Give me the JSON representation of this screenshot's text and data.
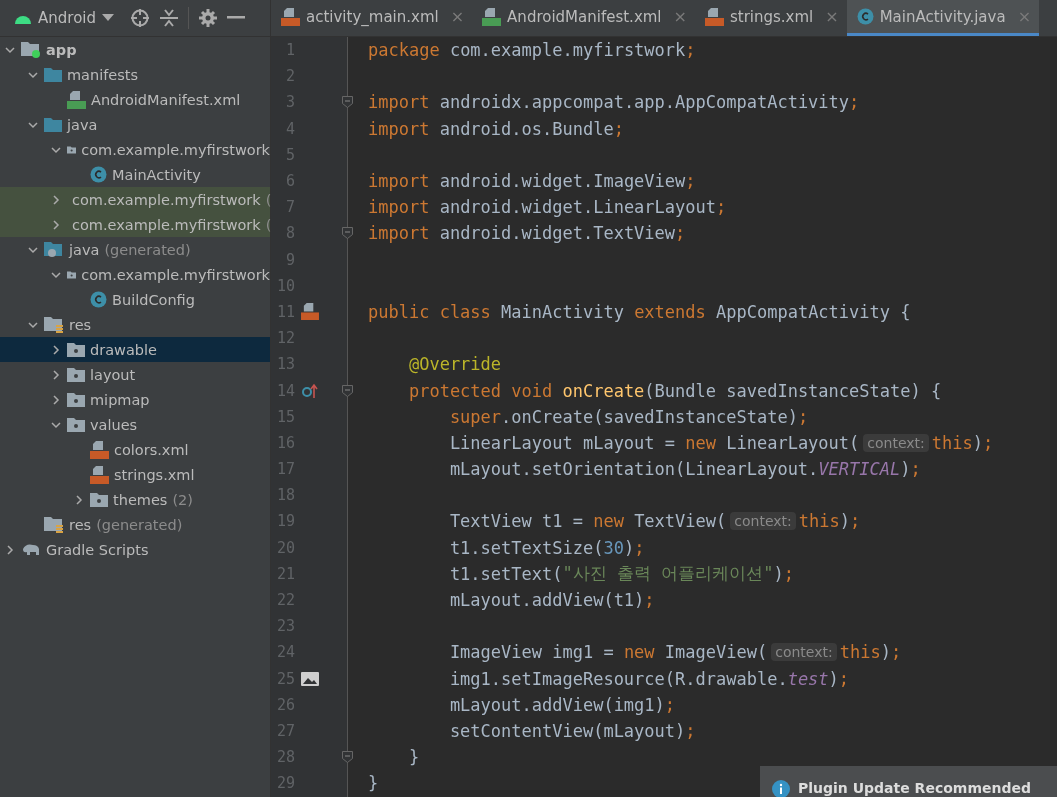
{
  "project_view": {
    "label": "Android"
  },
  "tabs": [
    {
      "label": "activity_main.xml",
      "kind": "xml",
      "selected": false,
      "close": "×"
    },
    {
      "label": "AndroidManifest.xml",
      "kind": "manifest",
      "selected": false,
      "close": "×"
    },
    {
      "label": "strings.xml",
      "kind": "xml",
      "selected": false,
      "close": "×"
    },
    {
      "label": "MainActivity.java",
      "kind": "class",
      "selected": true,
      "close": "×"
    }
  ],
  "tree": [
    {
      "label": "app",
      "kind": "module",
      "bold": true,
      "expanded": true,
      "selected": false,
      "highlighted": false,
      "children": [
        {
          "label": "manifests",
          "kind": "folder",
          "expanded": true,
          "selected": false,
          "highlighted": false,
          "children": [
            {
              "label": "AndroidManifest.xml",
              "kind": "manifest",
              "selected": false,
              "highlighted": false
            }
          ]
        },
        {
          "label": "java",
          "kind": "folder",
          "expanded": true,
          "selected": false,
          "highlighted": false,
          "children": [
            {
              "label": "com.example.myfirstwork",
              "kind": "package",
              "expanded": true,
              "selected": false,
              "highlighted": false,
              "children": [
                {
                  "label": "MainActivity",
                  "kind": "class",
                  "selected": false,
                  "highlighted": false
                }
              ]
            },
            {
              "label": "com.example.myfirstwork",
              "note": "(",
              "kind": "package",
              "expanded": false,
              "selected": false,
              "highlighted": true
            },
            {
              "label": "com.example.myfirstwork",
              "note": "(",
              "kind": "package",
              "expanded": false,
              "selected": false,
              "highlighted": true
            }
          ]
        },
        {
          "label": "java",
          "note": "(generated)",
          "kind": "generated",
          "expanded": true,
          "selected": false,
          "highlighted": false,
          "children": [
            {
              "label": "com.example.myfirstwork",
              "kind": "package",
              "expanded": true,
              "selected": false,
              "highlighted": false,
              "children": [
                {
                  "label": "BuildConfig",
                  "kind": "class",
                  "selected": false,
                  "highlighted": false
                }
              ]
            }
          ]
        },
        {
          "label": "res",
          "kind": "res",
          "expanded": true,
          "selected": false,
          "highlighted": false,
          "children": [
            {
              "label": "drawable",
              "kind": "package",
              "expanded": false,
              "selected": true,
              "highlighted": false
            },
            {
              "label": "layout",
              "kind": "package",
              "expanded": false,
              "selected": false,
              "highlighted": false
            },
            {
              "label": "mipmap",
              "kind": "package",
              "expanded": false,
              "selected": false,
              "highlighted": false
            },
            {
              "label": "values",
              "kind": "package",
              "expanded": true,
              "selected": false,
              "highlighted": false,
              "children": [
                {
                  "label": "colors.xml",
                  "kind": "xml",
                  "selected": false,
                  "highlighted": false
                },
                {
                  "label": "strings.xml",
                  "kind": "xml",
                  "selected": false,
                  "highlighted": false
                },
                {
                  "label": "themes",
                  "note": "(2)",
                  "kind": "package",
                  "expanded": false,
                  "selected": false,
                  "highlighted": false
                }
              ]
            }
          ]
        },
        {
          "label": "res",
          "note": "(generated)",
          "kind": "res",
          "selected": false,
          "highlighted": false
        }
      ]
    },
    {
      "label": "Gradle Scripts",
      "kind": "gradle",
      "expanded": false,
      "selected": false,
      "highlighted": false
    }
  ],
  "code": [
    {
      "number": "1",
      "kind": "plain",
      "tokens": [
        {
          "kind": "kw",
          "text": "package"
        },
        {
          "kind": "plain",
          "text": " com.example.myfirstwork"
        },
        {
          "kind": "kw",
          "text": ";"
        }
      ]
    },
    {
      "number": "2",
      "kind": "plain"
    },
    {
      "number": "3",
      "kind": "fold",
      "tokens": [
        {
          "kind": "kw",
          "text": "import"
        },
        {
          "kind": "plain",
          "text": " androidx.appcompat.app.AppCompatActivity"
        },
        {
          "kind": "kw",
          "text": ";"
        }
      ]
    },
    {
      "number": "4",
      "kind": "plain",
      "tokens": [
        {
          "kind": "kw",
          "text": "import"
        },
        {
          "kind": "plain",
          "text": " android.os.Bundle"
        },
        {
          "kind": "kw",
          "text": ";"
        }
      ]
    },
    {
      "number": "5",
      "kind": "plain"
    },
    {
      "number": "6",
      "kind": "plain",
      "tokens": [
        {
          "kind": "kw",
          "text": "import"
        },
        {
          "kind": "plain",
          "text": " android.widget.ImageView"
        },
        {
          "kind": "kw",
          "text": ";"
        }
      ]
    },
    {
      "number": "7",
      "kind": "plain",
      "tokens": [
        {
          "kind": "kw",
          "text": "import"
        },
        {
          "kind": "plain",
          "text": " android.widget.LinearLayout"
        },
        {
          "kind": "kw",
          "text": ";"
        }
      ]
    },
    {
      "number": "8",
      "kind": "fold",
      "tokens": [
        {
          "kind": "kw",
          "text": "import"
        },
        {
          "kind": "plain",
          "text": " android.widget.TextView"
        },
        {
          "kind": "kw",
          "text": ";"
        }
      ]
    },
    {
      "number": "9",
      "kind": "plain"
    },
    {
      "number": "10",
      "kind": "plain"
    },
    {
      "number": "11",
      "kind": "xml",
      "tokens": [
        {
          "kind": "kw",
          "text": "public class"
        },
        {
          "kind": "plain",
          "text": " MainActivity "
        },
        {
          "kind": "kw",
          "text": "extends"
        },
        {
          "kind": "plain",
          "text": " AppCompatActivity {"
        }
      ]
    },
    {
      "number": "12",
      "kind": "plain"
    },
    {
      "number": "13",
      "kind": "plain",
      "tokens": [
        {
          "kind": "ann",
          "text": "    @Override"
        }
      ]
    },
    {
      "number": "14",
      "kind": "override",
      "tokens": [
        {
          "kind": "kw",
          "text": "    protected void"
        },
        {
          "kind": "method",
          "text": " onCreate"
        },
        {
          "kind": "plain",
          "text": "(Bundle savedInstanceState) {"
        }
      ]
    },
    {
      "number": "15",
      "kind": "plain",
      "tokens": [
        {
          "kind": "kw",
          "text": "        super"
        },
        {
          "kind": "plain",
          "text": ".onCreate(savedInstanceState)"
        },
        {
          "kind": "kw",
          "text": ";"
        }
      ]
    },
    {
      "number": "16",
      "kind": "plain",
      "tokens": [
        {
          "kind": "plain",
          "text": "        LinearLayout mLayout = "
        },
        {
          "kind": "kw",
          "text": "new"
        },
        {
          "kind": "plain",
          "text": " LinearLayout("
        },
        {
          "kind": "hint",
          "text": "context:"
        },
        {
          "kind": "kw",
          "text": "this"
        },
        {
          "kind": "plain",
          "text": ")"
        },
        {
          "kind": "kw",
          "text": ";"
        }
      ]
    },
    {
      "number": "17",
      "kind": "plain",
      "tokens": [
        {
          "kind": "plain",
          "text": "        mLayout.setOrientation(LinearLayout."
        },
        {
          "kind": "field",
          "text": "VERTICAL"
        },
        {
          "kind": "plain",
          "text": ")"
        },
        {
          "kind": "kw",
          "text": ";"
        }
      ]
    },
    {
      "number": "18",
      "kind": "plain"
    },
    {
      "number": "19",
      "kind": "plain",
      "tokens": [
        {
          "kind": "plain",
          "text": "        TextView t1 = "
        },
        {
          "kind": "kw",
          "text": "new"
        },
        {
          "kind": "plain",
          "text": " TextView("
        },
        {
          "kind": "hint",
          "text": "context:"
        },
        {
          "kind": "kw",
          "text": "this"
        },
        {
          "kind": "plain",
          "text": ")"
        },
        {
          "kind": "kw",
          "text": ";"
        }
      ]
    },
    {
      "number": "20",
      "kind": "plain",
      "tokens": [
        {
          "kind": "plain",
          "text": "        t1.setTextSize("
        },
        {
          "kind": "num",
          "text": "30"
        },
        {
          "kind": "plain",
          "text": ")"
        },
        {
          "kind": "kw",
          "text": ";"
        }
      ]
    },
    {
      "number": "21",
      "kind": "plain",
      "tokens": [
        {
          "kind": "plain",
          "text": "        t1.setText("
        },
        {
          "kind": "str",
          "text": "\"사진 출력 어플리케이션\""
        },
        {
          "kind": "plain",
          "text": ")"
        },
        {
          "kind": "kw",
          "text": ";"
        }
      ]
    },
    {
      "number": "22",
      "kind": "plain",
      "tokens": [
        {
          "kind": "plain",
          "text": "        mLayout.addView(t1)"
        },
        {
          "kind": "kw",
          "text": ";"
        }
      ]
    },
    {
      "number": "23",
      "kind": "plain"
    },
    {
      "number": "24",
      "kind": "plain",
      "tokens": [
        {
          "kind": "plain",
          "text": "        ImageView img1 = "
        },
        {
          "kind": "kw",
          "text": "new"
        },
        {
          "kind": "plain",
          "text": " ImageView("
        },
        {
          "kind": "hint",
          "text": "context:"
        },
        {
          "kind": "kw",
          "text": "this"
        },
        {
          "kind": "plain",
          "text": ")"
        },
        {
          "kind": "kw",
          "text": ";"
        }
      ]
    },
    {
      "number": "25",
      "kind": "image",
      "tokens": [
        {
          "kind": "plain",
          "text": "        img1.setImageResource(R.drawable."
        },
        {
          "kind": "field",
          "text": "test"
        },
        {
          "kind": "plain",
          "text": ")"
        },
        {
          "kind": "kw",
          "text": ";"
        }
      ]
    },
    {
      "number": "26",
      "kind": "plain",
      "tokens": [
        {
          "kind": "plain",
          "text": "        mLayout.addView(img1)"
        },
        {
          "kind": "kw",
          "text": ";"
        }
      ]
    },
    {
      "number": "27",
      "kind": "plain",
      "tokens": [
        {
          "kind": "plain",
          "text": "        setContentView(mLayout)"
        },
        {
          "kind": "kw",
          "text": ";"
        }
      ]
    },
    {
      "number": "28",
      "kind": "fold",
      "tokens": [
        {
          "kind": "plain",
          "text": "    }"
        }
      ]
    },
    {
      "number": "29",
      "kind": "plain",
      "tokens": [
        {
          "kind": "plain",
          "text": "}"
        }
      ]
    }
  ],
  "notification": {
    "title": "Plugin Update Recommended"
  }
}
